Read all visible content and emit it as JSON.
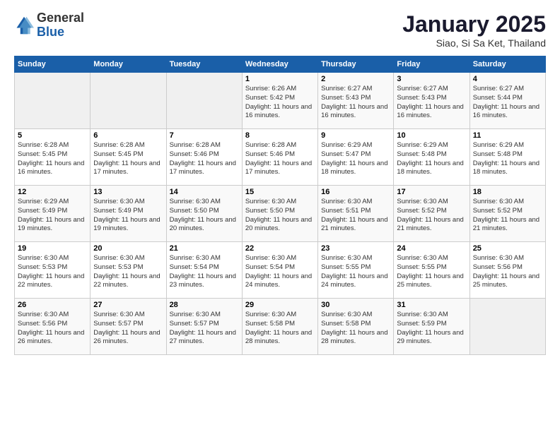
{
  "logo": {
    "general": "General",
    "blue": "Blue"
  },
  "header": {
    "title": "January 2025",
    "subtitle": "Siao, Si Sa Ket, Thailand"
  },
  "weekdays": [
    "Sunday",
    "Monday",
    "Tuesday",
    "Wednesday",
    "Thursday",
    "Friday",
    "Saturday"
  ],
  "weeks": [
    [
      {
        "day": "",
        "info": ""
      },
      {
        "day": "",
        "info": ""
      },
      {
        "day": "",
        "info": ""
      },
      {
        "day": "1",
        "info": "Sunrise: 6:26 AM\nSunset: 5:42 PM\nDaylight: 11 hours\nand 16 minutes."
      },
      {
        "day": "2",
        "info": "Sunrise: 6:27 AM\nSunset: 5:43 PM\nDaylight: 11 hours\nand 16 minutes."
      },
      {
        "day": "3",
        "info": "Sunrise: 6:27 AM\nSunset: 5:43 PM\nDaylight: 11 hours\nand 16 minutes."
      },
      {
        "day": "4",
        "info": "Sunrise: 6:27 AM\nSunset: 5:44 PM\nDaylight: 11 hours\nand 16 minutes."
      }
    ],
    [
      {
        "day": "5",
        "info": "Sunrise: 6:28 AM\nSunset: 5:45 PM\nDaylight: 11 hours\nand 16 minutes."
      },
      {
        "day": "6",
        "info": "Sunrise: 6:28 AM\nSunset: 5:45 PM\nDaylight: 11 hours\nand 17 minutes."
      },
      {
        "day": "7",
        "info": "Sunrise: 6:28 AM\nSunset: 5:46 PM\nDaylight: 11 hours\nand 17 minutes."
      },
      {
        "day": "8",
        "info": "Sunrise: 6:28 AM\nSunset: 5:46 PM\nDaylight: 11 hours\nand 17 minutes."
      },
      {
        "day": "9",
        "info": "Sunrise: 6:29 AM\nSunset: 5:47 PM\nDaylight: 11 hours\nand 18 minutes."
      },
      {
        "day": "10",
        "info": "Sunrise: 6:29 AM\nSunset: 5:48 PM\nDaylight: 11 hours\nand 18 minutes."
      },
      {
        "day": "11",
        "info": "Sunrise: 6:29 AM\nSunset: 5:48 PM\nDaylight: 11 hours\nand 18 minutes."
      }
    ],
    [
      {
        "day": "12",
        "info": "Sunrise: 6:29 AM\nSunset: 5:49 PM\nDaylight: 11 hours\nand 19 minutes."
      },
      {
        "day": "13",
        "info": "Sunrise: 6:30 AM\nSunset: 5:49 PM\nDaylight: 11 hours\nand 19 minutes."
      },
      {
        "day": "14",
        "info": "Sunrise: 6:30 AM\nSunset: 5:50 PM\nDaylight: 11 hours\nand 20 minutes."
      },
      {
        "day": "15",
        "info": "Sunrise: 6:30 AM\nSunset: 5:50 PM\nDaylight: 11 hours\nand 20 minutes."
      },
      {
        "day": "16",
        "info": "Sunrise: 6:30 AM\nSunset: 5:51 PM\nDaylight: 11 hours\nand 21 minutes."
      },
      {
        "day": "17",
        "info": "Sunrise: 6:30 AM\nSunset: 5:52 PM\nDaylight: 11 hours\nand 21 minutes."
      },
      {
        "day": "18",
        "info": "Sunrise: 6:30 AM\nSunset: 5:52 PM\nDaylight: 11 hours\nand 21 minutes."
      }
    ],
    [
      {
        "day": "19",
        "info": "Sunrise: 6:30 AM\nSunset: 5:53 PM\nDaylight: 11 hours\nand 22 minutes."
      },
      {
        "day": "20",
        "info": "Sunrise: 6:30 AM\nSunset: 5:53 PM\nDaylight: 11 hours\nand 22 minutes."
      },
      {
        "day": "21",
        "info": "Sunrise: 6:30 AM\nSunset: 5:54 PM\nDaylight: 11 hours\nand 23 minutes."
      },
      {
        "day": "22",
        "info": "Sunrise: 6:30 AM\nSunset: 5:54 PM\nDaylight: 11 hours\nand 24 minutes."
      },
      {
        "day": "23",
        "info": "Sunrise: 6:30 AM\nSunset: 5:55 PM\nDaylight: 11 hours\nand 24 minutes."
      },
      {
        "day": "24",
        "info": "Sunrise: 6:30 AM\nSunset: 5:55 PM\nDaylight: 11 hours\nand 25 minutes."
      },
      {
        "day": "25",
        "info": "Sunrise: 6:30 AM\nSunset: 5:56 PM\nDaylight: 11 hours\nand 25 minutes."
      }
    ],
    [
      {
        "day": "26",
        "info": "Sunrise: 6:30 AM\nSunset: 5:56 PM\nDaylight: 11 hours\nand 26 minutes."
      },
      {
        "day": "27",
        "info": "Sunrise: 6:30 AM\nSunset: 5:57 PM\nDaylight: 11 hours\nand 26 minutes."
      },
      {
        "day": "28",
        "info": "Sunrise: 6:30 AM\nSunset: 5:57 PM\nDaylight: 11 hours\nand 27 minutes."
      },
      {
        "day": "29",
        "info": "Sunrise: 6:30 AM\nSunset: 5:58 PM\nDaylight: 11 hours\nand 28 minutes."
      },
      {
        "day": "30",
        "info": "Sunrise: 6:30 AM\nSunset: 5:58 PM\nDaylight: 11 hours\nand 28 minutes."
      },
      {
        "day": "31",
        "info": "Sunrise: 6:30 AM\nSunset: 5:59 PM\nDaylight: 11 hours\nand 29 minutes."
      },
      {
        "day": "",
        "info": ""
      }
    ]
  ]
}
